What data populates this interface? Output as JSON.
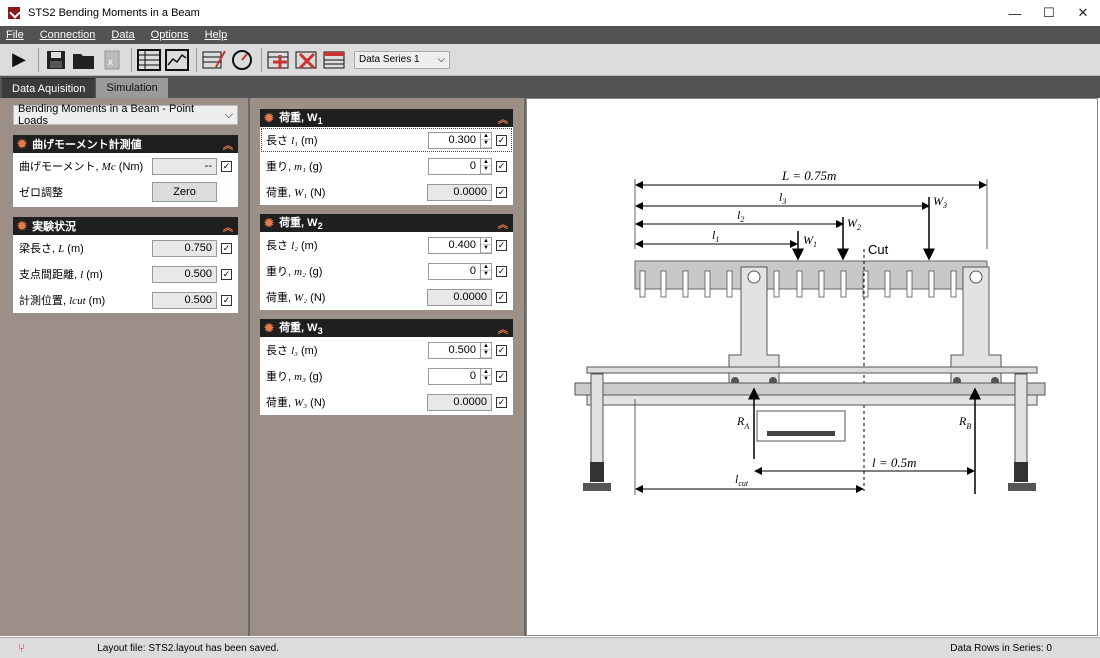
{
  "window": {
    "title": "STS2 Bending Moments in a Beam",
    "minimize": "—",
    "maximize": "☐",
    "close": "✕"
  },
  "menu": [
    "File",
    "Connection",
    "Data",
    "Options",
    "Help"
  ],
  "toolbar": {
    "data_series": "Data Series 1"
  },
  "tabs": [
    "Data Aquisition",
    "Simulation"
  ],
  "left": {
    "selector": "Bending Moments in a Beam - Point Loads",
    "panel1": {
      "title": "曲げモーメント計測値",
      "rows": [
        {
          "label": "曲げモーメント, ",
          "sym": "Mc",
          "unit": " (Nm)",
          "value": "--"
        }
      ],
      "zero_label": "ゼロ調整",
      "zero_button": "Zero"
    },
    "panel2": {
      "title": "実験状況",
      "rows": [
        {
          "label": "梁長さ, ",
          "sym": "L",
          "unit": " (m)",
          "value": "0.750"
        },
        {
          "label": "支点間距離, ",
          "sym": "l",
          "unit": " (m)",
          "value": "0.500"
        },
        {
          "label": "計測位置, ",
          "sym": "lcut",
          "unit": " (m)",
          "value": "0.500"
        }
      ]
    }
  },
  "loads": [
    {
      "title": "荷重, W",
      "idx": "1",
      "rows": [
        {
          "label": "長さ ",
          "sym": "l₁",
          "unit": " (m)",
          "value": "0.300"
        },
        {
          "label": "重り, ",
          "sym": "m₁",
          "unit": " (g)",
          "value": "0"
        },
        {
          "label": "荷重, ",
          "sym": "W₁",
          "unit": " (N)",
          "value": "0.0000"
        }
      ]
    },
    {
      "title": "荷重, W",
      "idx": "2",
      "rows": [
        {
          "label": "長さ ",
          "sym": "l₂",
          "unit": " (m)",
          "value": "0.400"
        },
        {
          "label": "重り, ",
          "sym": "m₂",
          "unit": " (g)",
          "value": "0"
        },
        {
          "label": "荷重, ",
          "sym": "W₂",
          "unit": " (N)",
          "value": "0.0000"
        }
      ]
    },
    {
      "title": "荷重, W",
      "idx": "3",
      "rows": [
        {
          "label": "長さ ",
          "sym": "l₃",
          "unit": " (m)",
          "value": "0.500"
        },
        {
          "label": "重り, ",
          "sym": "m₃",
          "unit": " (g)",
          "value": "0"
        },
        {
          "label": "荷重, ",
          "sym": "W₃",
          "unit": " (N)",
          "value": "0.0000"
        }
      ]
    }
  ],
  "diagram": {
    "L_label": "L = 0.75m",
    "l1": "l",
    "l1s": "1",
    "l2": "l",
    "l2s": "2",
    "l3": "l",
    "l3s": "3",
    "W1": "W",
    "W1s": "1",
    "W2": "W",
    "W2s": "2",
    "W3": "W",
    "W3s": "3",
    "cut": "Cut",
    "RA": "R",
    "RAs": "A",
    "RB": "R",
    "RBs": "B",
    "l_label": "l = 0.5m",
    "lcut": "l",
    "lcuts": "cut"
  },
  "status": {
    "layout": "Layout file: STS2.layout has been saved.",
    "rows": "Data Rows in Series: 0"
  }
}
